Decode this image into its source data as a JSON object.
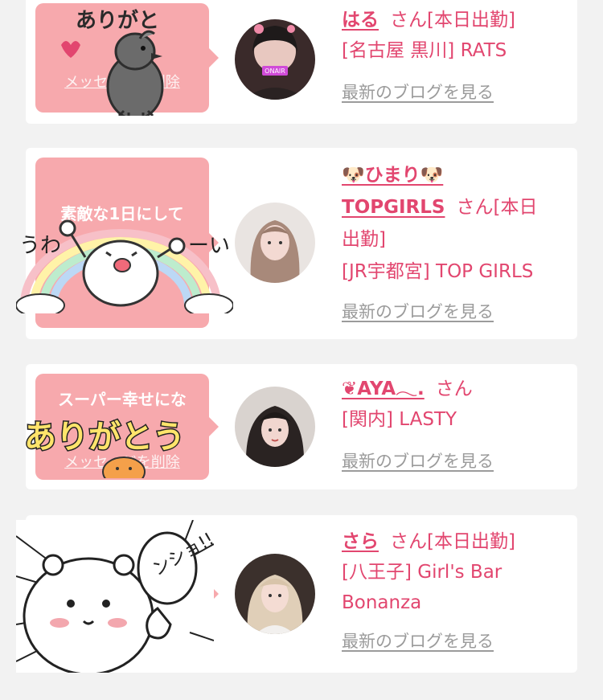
{
  "cards": [
    {
      "sticker_text": "ありがと",
      "bubble_line1": "",
      "delete_link": "メッセージを削除",
      "name": "はる",
      "suffix": "さん[本日出勤]",
      "shop": "[名古屋 黒川] RATS",
      "blog_link": "最新のブログを見る"
    },
    {
      "sticker_text_left": "うわ",
      "sticker_text_right": "ーい",
      "bubble_line1": "素敵な1日にして",
      "name": "🐶ひまり🐶TOPGIRLS",
      "name_line1": "🐶ひまり🐶",
      "name_line2": "TOPGIRLS",
      "suffix": "さん[本日出勤]",
      "suffix_a": "さん[本日",
      "suffix_b": "出勤]",
      "shop": "[JR宇都宮] TOP GIRLS",
      "blog_link": "最新のブログを見る"
    },
    {
      "bubble_line1": "スーパー幸せにな",
      "sticker_text": "ありがとう",
      "delete_link": "メッセージを削除",
      "name": "❦AYA𓂃.",
      "suffix": "さん",
      "shop": "[関内] LASTY",
      "blog_link": "最新のブログを見る"
    },
    {
      "sticker_text": "ンショ!!",
      "name": "さら",
      "suffix": "さん[本日出勤]",
      "shop": "[八王子] Girl's Bar Bonanza",
      "blog_link": "最新のブログを見る"
    }
  ],
  "colors": {
    "accent": "#e2466f",
    "bubble": "#f7a9ad",
    "link_gray": "#9b9b9b",
    "background": "#f2f2f2"
  }
}
